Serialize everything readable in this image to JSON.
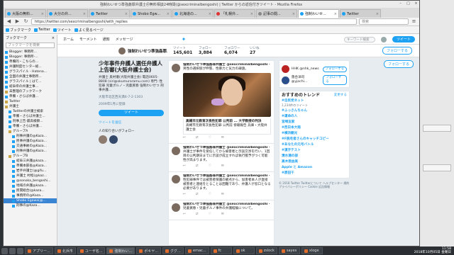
{
  "window": {
    "title": "強制わいせつ準強姦罪弁護士＠無料相談24時間(@sexcriminalbengoshi) | Twitter からの返信付きツイート - Mozilla Firefox",
    "controls": [
      "–",
      "□",
      "×"
    ]
  },
  "tabs": [
    {
      "label": "大阪の無料...",
      "fav": "blue",
      "active": false
    },
    {
      "label": "大分の弁...",
      "fav": "blue",
      "active": false
    },
    {
      "label": "Twitter",
      "fav": "blue",
      "active": false
    },
    {
      "label": "Shobo Egw...",
      "fav": "blue",
      "active": false
    },
    {
      "label": "北海道の...",
      "fav": "blue",
      "active": false
    },
    {
      "label": "「札幌弁...",
      "fav": "red",
      "active": false
    },
    {
      "label": "記事の閲...",
      "fav": "gray",
      "active": false
    },
    {
      "label": "強制わいせ...",
      "fav": "blue",
      "active": true
    },
    {
      "label": "Twitter",
      "fav": "blue",
      "active": false
    }
  ],
  "nav": {
    "back": "◀",
    "forward": "▶",
    "reload": "↻",
    "url": "https://twitter.com/sexcriminalbengoshi/with_replies",
    "search_placeholder": "検索",
    "menu": "≡"
  },
  "bookmarks_bar": [
    {
      "label": "ブックマーク"
    },
    {
      "label": "Twitter"
    },
    {
      "label": "ツイート"
    },
    {
      "label": "よく見るページ"
    }
  ],
  "sidebar": {
    "title": "ブックマーク",
    "close": "×",
    "search_placeholder": "ブックマークを検索",
    "items": [
      {
        "label": "Blogger: 事務所...",
        "type": "page",
        "depth": 1
      },
      {
        "label": "Blogger: 事務所-...",
        "type": "page",
        "depth": 1
      },
      {
        "label": "準備的・こちらの...",
        "type": "page",
        "depth": 1
      },
      {
        "label": "弁護制度センター総...",
        "type": "page",
        "depth": 1
      },
      {
        "label": "グラスパイル - Hatena...",
        "type": "page",
        "depth": 1
      },
      {
        "label": "全国の弁護士事務所...",
        "type": "page",
        "depth": 1
      },
      {
        "label": "グラスパイル | はて...",
        "type": "page",
        "depth": 1
      },
      {
        "label": "岐阜県の弁護士事...",
        "type": "page",
        "depth": 1
      },
      {
        "label": "未整理のブックマーク",
        "type": "folder",
        "depth": 1
      },
      {
        "label": "準備・さらば弁護...",
        "type": "page",
        "depth": 1
      },
      {
        "label": "Twitter",
        "type": "folder",
        "depth": 1
      },
      {
        "label": "弁護士",
        "type": "folder",
        "depth": 1
      },
      {
        "label": "Twitterの弁護士検索",
        "type": "page",
        "depth": 2
      },
      {
        "label": "準備・さらば弁護士...",
        "type": "page",
        "depth": 2
      },
      {
        "label": "刑事上告·最高検察...",
        "type": "page",
        "depth": 2
      },
      {
        "label": "準備・さらば弁護...",
        "type": "page",
        "depth": 2
      },
      {
        "label": "グループA",
        "type": "folder",
        "depth": 2
      },
      {
        "label": "刑事弁護の@Kaza...",
        "type": "page",
        "depth": 3
      },
      {
        "label": "民事弁護の@Kaza...",
        "type": "page",
        "depth": 3
      },
      {
        "label": "交通事故の@Kaza...",
        "type": "page",
        "depth": 3
      },
      {
        "label": "刑事弁護の@Kaza...",
        "type": "page",
        "depth": 3
      },
      {
        "label": "グループB",
        "type": "folder",
        "depth": 2
      },
      {
        "label": "岐阜三弁護@kaza...",
        "type": "page",
        "depth": 3
      },
      {
        "label": "準備本部長@Kaza...",
        "type": "page",
        "depth": 3
      },
      {
        "label": "岩手弁護士(@gifu...",
        "type": "page",
        "depth": 3
      },
      {
        "label": "弁護士 村松(@kaz...",
        "type": "page",
        "depth": 3
      },
      {
        "label": "@sonoka_bengoshi...",
        "type": "page",
        "depth": 3
      },
      {
        "label": "地域の弁護@kaza...",
        "type": "page",
        "depth": 3
      },
      {
        "label": "民間総合(@kaza...",
        "type": "page",
        "depth": 3
      },
      {
        "label": "事務所の@Kaza...",
        "type": "page",
        "depth": 3
      },
      {
        "label": "Shobo Egawa(@...",
        "type": "page",
        "depth": 3,
        "selected": true
      },
      {
        "label": "刑事の@Kaza...",
        "type": "page",
        "depth": 3
      }
    ]
  },
  "twitter_nav": {
    "home": "ホーム",
    "moments": "モーメント",
    "notifications": "通知",
    "messages": "メッセージ",
    "search_placeholder": "キーワード検索",
    "tweet_button": "ツイート"
  },
  "profile_strip": {
    "name": "強制わいせつ準強姦罪...",
    "stats": [
      {
        "label": "ツイート",
        "value": "145,601"
      },
      {
        "label": "フォロー",
        "value": "3,884"
      },
      {
        "label": "フォロワー",
        "value": "6,074"
      },
      {
        "label": "いいね",
        "value": "27"
      }
    ],
    "follow_label": "フォローする"
  },
  "profile": {
    "headline": "少年事件弁護人選任弁護人上告審(大阪弁護士会)",
    "bio": "弁護士 奥村徹(大阪弁護士会) 電話0605-8808 (siri@okumuraramu.com) 専門: 性犯罪 児童ポルノ・児童買春 強制わいせつ 刑事弁護...",
    "location": "大阪市北区西天満6-7-2-1303",
    "joined": "2009年1月に登録",
    "tweet_button": "ツイート",
    "subscribe": "ツイートを送信",
    "followers_you_know": "人の知り合いがフォロー"
  },
  "tweets": [
    {
      "author": "強制わいせつ準強姦罪弁護士 @sexcriminalbengoshi · 4時間",
      "body": "男性の選択肢が伸張、性暴力と気力の疎遠。",
      "has_photo": true,
      "link_title": "高槻市元教育次長性犯罪 公判前 ... 大学教授の判決",
      "link_desc": "高槻市元教育次長性犯罪 公判前 傍聴報告 兵庫・大阪弁護士会"
    },
    {
      "author": "強制わいせつ準強姦罪弁護士 @sexcriminalbengoshi · 8時間",
      "body": "弁護士が事件を受任してから被害者と示談交渉を行い、1回目の公判期日までに示談が成立すれば執行猶予がつく可能性が高まります。",
      "has_photo": false
    },
    {
      "author": "強制わいせつ準強姦罪弁護士 @sexcriminalbengoshi · 9時間",
      "body": "性犯罪事件では被害者保護の観点から、加害者本人が直接被害者と連絡をとることは困難であり、弁護人が窓口となる必要があります。",
      "has_photo": false
    },
    {
      "author": "強制わいせつ準強姦罪弁護士 @sexcriminalbengoshi · 12時間",
      "body": "児童買春・児童ポルノ事件の弁護経験について。",
      "has_photo": false
    }
  ],
  "right": {
    "who_to_follow": [
      {
        "name": "HHK @nhk_news",
        "follow": "フォローする"
      },
      {
        "name": "落合洋司 @yjochi...",
        "follow": "フォローする"
      }
    ],
    "trends_title": "おすすめのトレンド",
    "trends_change": "変更する",
    "trends": [
      {
        "name": "#自民党ネット",
        "count": "1,234件のツイート"
      },
      {
        "name": "#ふっさんちゃん",
        "count": ""
      },
      {
        "name": "#運命の人",
        "count": ""
      },
      {
        "name": "宮崎友家",
        "count": ""
      },
      {
        "name": "#西日本大雨",
        "count": ""
      },
      {
        "name": "#横浜観光",
        "count": ""
      },
      {
        "name": "#F脱毛者さんのキャッチコピー",
        "count": ""
      },
      {
        "name": "#あなたの元号バトル",
        "count": ""
      },
      {
        "name": "#漢字テスト",
        "count": ""
      },
      {
        "name": "清水達の部",
        "count": ""
      },
      {
        "name": "高木亜由美",
        "count": ""
      },
      {
        "name": "Apple と Amazon",
        "count": ""
      },
      {
        "name": "#原田千",
        "count": ""
      }
    ],
    "footer": "© 2018 Twitter  Twitterについて  ヘルプセンター  規約  プライバシーポリシー  Cookie  広告情報"
  },
  "taskbar": {
    "items": [
      {
        "label": "アプリー...",
        "active": false
      },
      {
        "label": "北浜市",
        "active": false
      },
      {
        "label": "ユーザ名...",
        "active": false
      },
      {
        "label": "強制わい...",
        "active": true
      },
      {
        "label": "ポキヤ...",
        "active": false
      },
      {
        "label": "ググ...",
        "active": false
      },
      {
        "label": "emac...",
        "active": false
      },
      {
        "label": "fc",
        "active": false
      },
      {
        "label": "ok",
        "active": false
      },
      {
        "label": "zslock",
        "active": false
      },
      {
        "label": "sayes",
        "active": false
      },
      {
        "label": "xloge",
        "active": false
      }
    ],
    "time": "11:58",
    "date": "2018年10月05日 金曜日"
  }
}
